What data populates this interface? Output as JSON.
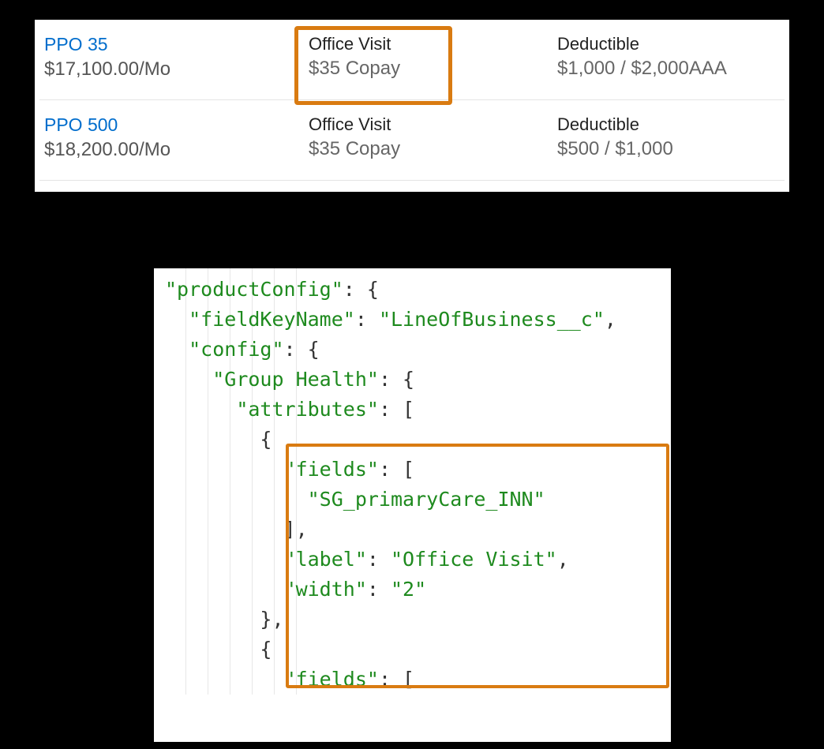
{
  "plans": [
    {
      "name": "PPO 35",
      "price": "$17,100.00/Mo",
      "office_visit_label": "Office Visit",
      "office_visit_value": "$35 Copay",
      "deductible_label": "Deductible",
      "deductible_value": "$1,000 / $2,000AAA",
      "highlight": true
    },
    {
      "name": "PPO 500",
      "price": "$18,200.00/Mo",
      "office_visit_label": "Office Visit",
      "office_visit_value": "$35 Copay",
      "deductible_label": "Deductible",
      "deductible_value": "$500 / $1,000",
      "highlight": false
    }
  ],
  "code": {
    "l1_key": "\"productConfig\"",
    "l2_key": "\"fieldKeyName\"",
    "l2_val": "\"LineOfBusiness__c\"",
    "l3_key": "\"config\"",
    "l4_key": "\"Group Health\"",
    "l5_key": "\"attributes\"",
    "l7_key": "\"fields\"",
    "l8_val": "\"SG_primaryCare_INN\"",
    "l10_key": "\"label\"",
    "l10_val": "\"Office Visit\"",
    "l11_key": "\"width\"",
    "l11_val": "\"2\"",
    "l14_key": "\"fields\""
  },
  "highlight_color": "#d97b11",
  "link_color": "#006dcc"
}
